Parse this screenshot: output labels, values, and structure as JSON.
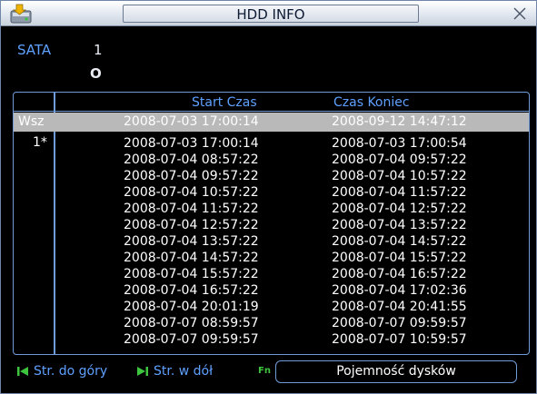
{
  "window": {
    "title": "HDD INFO"
  },
  "sata": {
    "label": "SATA",
    "number": "1",
    "status": "O"
  },
  "table": {
    "headers": {
      "start": "Start Czas",
      "end": "Czas Koniec"
    },
    "all_row": {
      "label": "Wsz",
      "start": "2008-07-03 17:00:14",
      "end": "2008-09-12 14:47:12"
    },
    "disk_label": "1*",
    "rows": [
      {
        "start": "2008-07-03 17:00:14",
        "end": "2008-07-03 17:00:54"
      },
      {
        "start": "2008-07-04 08:57:22",
        "end": "2008-07-04 09:57:22"
      },
      {
        "start": "2008-07-04 09:57:22",
        "end": "2008-07-04 10:57:22"
      },
      {
        "start": "2008-07-04 10:57:22",
        "end": "2008-07-04 11:57:22"
      },
      {
        "start": "2008-07-04 11:57:22",
        "end": "2008-07-04 12:57:22"
      },
      {
        "start": "2008-07-04 12:57:22",
        "end": "2008-07-04 13:57:22"
      },
      {
        "start": "2008-07-04 13:57:22",
        "end": "2008-07-04 14:57:22"
      },
      {
        "start": "2008-07-04 14:57:22",
        "end": "2008-07-04 15:57:22"
      },
      {
        "start": "2008-07-04 15:57:22",
        "end": "2008-07-04 16:57:22"
      },
      {
        "start": "2008-07-04 16:57:22",
        "end": "2008-07-04 17:02:36"
      },
      {
        "start": "2008-07-04 20:01:19",
        "end": "2008-07-04 20:41:55"
      },
      {
        "start": "2008-07-07 08:59:57",
        "end": "2008-07-07 09:59:57"
      },
      {
        "start": "2008-07-07 09:59:57",
        "end": "2008-07-07 10:59:57"
      }
    ]
  },
  "footer": {
    "page_up": "Str. do góry",
    "page_down": "Str. w dół",
    "fn": "Fn",
    "capacity_button": "Pojemność dysków"
  },
  "colors": {
    "accent": "#5fa0ff",
    "border": "#6f9cd8",
    "selected_row": "#b9b9b9",
    "icon_green": "#3ec43e"
  }
}
